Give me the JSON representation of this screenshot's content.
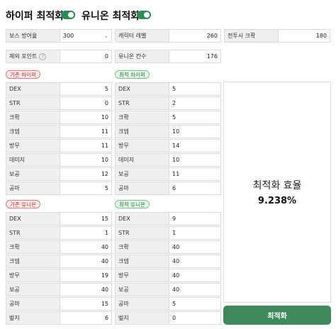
{
  "header": {
    "hyper_label": "하이퍼 최적화",
    "hyper_toggle_on": true,
    "union_label": "유니온 최적화",
    "union_toggle_on": true
  },
  "settings": {
    "boss_defense": {
      "label": "보스 방어율",
      "value": "300"
    },
    "char_level": {
      "label": "캐릭터 레벨",
      "value": "260"
    },
    "combat_crit": {
      "label": "전투시 크확",
      "value": "180"
    },
    "exclude_points": {
      "label": "제외 포인트",
      "value": "0"
    },
    "union_cells": {
      "label": "유니온 칸수",
      "value": "176"
    }
  },
  "existing_hyper": {
    "badge": "기존 하이퍼",
    "rows": [
      {
        "label": "DEX",
        "value": "5"
      },
      {
        "label": "STR",
        "value": "0"
      },
      {
        "label": "크확",
        "value": "10"
      },
      {
        "label": "크뎀",
        "value": "11"
      },
      {
        "label": "방무",
        "value": "11"
      },
      {
        "label": "데미지",
        "value": "10"
      },
      {
        "label": "보공",
        "value": "12"
      },
      {
        "label": "공마",
        "value": "5"
      }
    ]
  },
  "optimal_hyper": {
    "badge": "최적 하이퍼",
    "rows": [
      {
        "label": "DEX",
        "value": "5"
      },
      {
        "label": "STR",
        "value": "2"
      },
      {
        "label": "크확",
        "value": "5"
      },
      {
        "label": "크뎀",
        "value": "10"
      },
      {
        "label": "방무",
        "value": "14"
      },
      {
        "label": "데미지",
        "value": "10"
      },
      {
        "label": "보공",
        "value": "11"
      },
      {
        "label": "공마",
        "value": "6"
      }
    ]
  },
  "existing_union": {
    "badge": "기존 유니온",
    "rows": [
      {
        "label": "DEX",
        "value": "15"
      },
      {
        "label": "STR",
        "value": "1"
      },
      {
        "label": "크확",
        "value": "40"
      },
      {
        "label": "크뎀",
        "value": "40"
      },
      {
        "label": "방무",
        "value": "19"
      },
      {
        "label": "보공",
        "value": "40"
      },
      {
        "label": "공마",
        "value": "15"
      },
      {
        "label": "벞지",
        "value": "6"
      }
    ]
  },
  "optimal_union": {
    "badge": "최적 유니온",
    "rows": [
      {
        "label": "DEX",
        "value": "9"
      },
      {
        "label": "STR",
        "value": "1"
      },
      {
        "label": "크확",
        "value": "40"
      },
      {
        "label": "크뎀",
        "value": "40"
      },
      {
        "label": "방무",
        "value": "40"
      },
      {
        "label": "보공",
        "value": "40"
      },
      {
        "label": "공마",
        "value": "5"
      },
      {
        "label": "벞지",
        "value": "0"
      }
    ]
  },
  "efficiency": {
    "title": "최적화 효율",
    "value": "9.238%"
  },
  "optimize_button": "최적화",
  "colors": {
    "accent_green": "#3f8a5c",
    "toggle_green": "#2e8a57",
    "badge_red": "#c23a3a",
    "badge_green": "#2e7a45"
  }
}
